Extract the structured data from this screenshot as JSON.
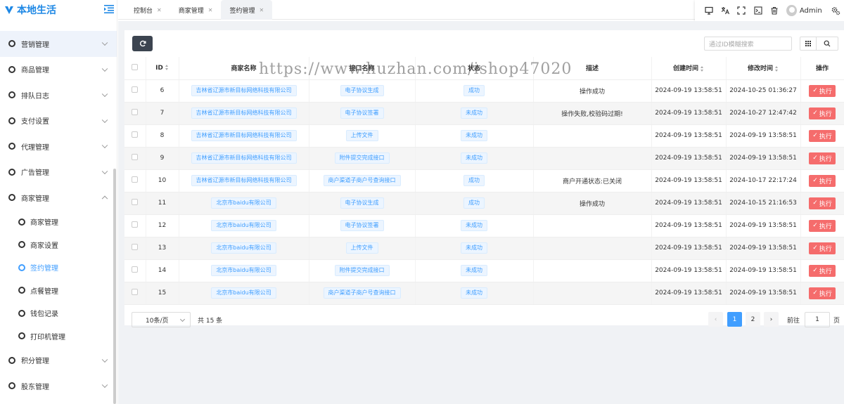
{
  "app": {
    "title": "本地生活",
    "brand_color": "#1e88e5"
  },
  "sidebar": {
    "items": [
      {
        "label": "营销管理",
        "expanded": false
      },
      {
        "label": "商品管理",
        "expanded": false
      },
      {
        "label": "排队日志",
        "expanded": false
      },
      {
        "label": "支付设置",
        "expanded": false
      },
      {
        "label": "代理管理",
        "expanded": false
      },
      {
        "label": "广告管理",
        "expanded": false
      },
      {
        "label": "商家管理",
        "expanded": true
      },
      {
        "label": "积分管理",
        "expanded": false
      },
      {
        "label": "股东管理",
        "expanded": false
      }
    ],
    "subitems": [
      {
        "label": "商家管理",
        "active": false
      },
      {
        "label": "商家设置",
        "active": false
      },
      {
        "label": "签约管理",
        "active": true
      },
      {
        "label": "点餐管理",
        "active": false
      },
      {
        "label": "钱包记录",
        "active": false
      },
      {
        "label": "打印机管理",
        "active": false
      }
    ]
  },
  "tabs": [
    {
      "label": "控制台",
      "active": false
    },
    {
      "label": "商家管理",
      "active": false
    },
    {
      "label": "签约管理",
      "active": true
    }
  ],
  "toolbar": {
    "user": "Admin",
    "icons": [
      "monitor-icon",
      "translate-icon",
      "fullscreen-icon",
      "terminal-icon",
      "trash-icon",
      "avatar",
      "settings-icon"
    ]
  },
  "search": {
    "placeholder": "通过ID模糊搜索"
  },
  "table": {
    "headers": {
      "id": "ID",
      "merchant": "商家名称",
      "api": "接口名称",
      "status": "状态",
      "desc": "描述",
      "created": "创建时间",
      "modified": "修改时间",
      "action": "操作"
    },
    "action_label": "执行",
    "rows": [
      {
        "id": "6",
        "merchant": "吉林省辽源市新目标网络科技有限公司",
        "api": "电子协议生成",
        "status": "成功",
        "desc": "操作成功",
        "created": "2024-09-19 13:58:51",
        "modified": "2024-10-25 01:36:27"
      },
      {
        "id": "7",
        "merchant": "吉林省辽源市新目标网络科技有限公司",
        "api": "电子协议签署",
        "status": "未成功",
        "desc": "操作失败,校验码过期!",
        "created": "2024-09-19 13:58:51",
        "modified": "2024-10-27 12:47:42"
      },
      {
        "id": "8",
        "merchant": "吉林省辽源市新目标网络科技有限公司",
        "api": "上传文件",
        "status": "未成功",
        "desc": "",
        "created": "2024-09-19 13:58:51",
        "modified": "2024-09-19 13:58:51"
      },
      {
        "id": "9",
        "merchant": "吉林省辽源市新目标网络科技有限公司",
        "api": "附件提交完成接口",
        "status": "未成功",
        "desc": "",
        "created": "2024-09-19 13:58:51",
        "modified": "2024-09-19 13:58:51"
      },
      {
        "id": "10",
        "merchant": "吉林省辽源市新目标网络科技有限公司",
        "api": "商户渠道子商户号查询接口",
        "status": "成功",
        "desc": "商户开通状态:已关闭",
        "created": "2024-09-19 13:58:51",
        "modified": "2024-10-17 22:17:24"
      },
      {
        "id": "11",
        "merchant": "北京市baidu有限公司",
        "api": "电子协议生成",
        "status": "成功",
        "desc": "操作成功",
        "created": "2024-09-19 13:58:51",
        "modified": "2024-10-15 21:16:53"
      },
      {
        "id": "12",
        "merchant": "北京市baidu有限公司",
        "api": "电子协议签署",
        "status": "未成功",
        "desc": "",
        "created": "2024-09-19 13:58:51",
        "modified": "2024-09-19 13:58:51"
      },
      {
        "id": "13",
        "merchant": "北京市baidu有限公司",
        "api": "上传文件",
        "status": "未成功",
        "desc": "",
        "created": "2024-09-19 13:58:51",
        "modified": "2024-09-19 13:58:51"
      },
      {
        "id": "14",
        "merchant": "北京市baidu有限公司",
        "api": "附件提交完成接口",
        "status": "未成功",
        "desc": "",
        "created": "2024-09-19 13:58:51",
        "modified": "2024-09-19 13:58:51"
      },
      {
        "id": "15",
        "merchant": "北京市baidu有限公司",
        "api": "商户渠道子商户号查询接口",
        "status": "未成功",
        "desc": "",
        "created": "2024-09-19 13:58:51",
        "modified": "2024-09-19 13:58:51"
      }
    ]
  },
  "pagination": {
    "page_size": "10条/页",
    "total": "共 15 条",
    "pages": [
      "1",
      "2"
    ],
    "current": "1",
    "goto_label": "前往",
    "goto_value": "1",
    "page_unit": "页"
  },
  "watermark": "https://www.huzhan.com/ishop47020",
  "colors": {
    "primary": "#409eff",
    "danger": "#f56c6c",
    "dark_button": "#3c4450"
  }
}
